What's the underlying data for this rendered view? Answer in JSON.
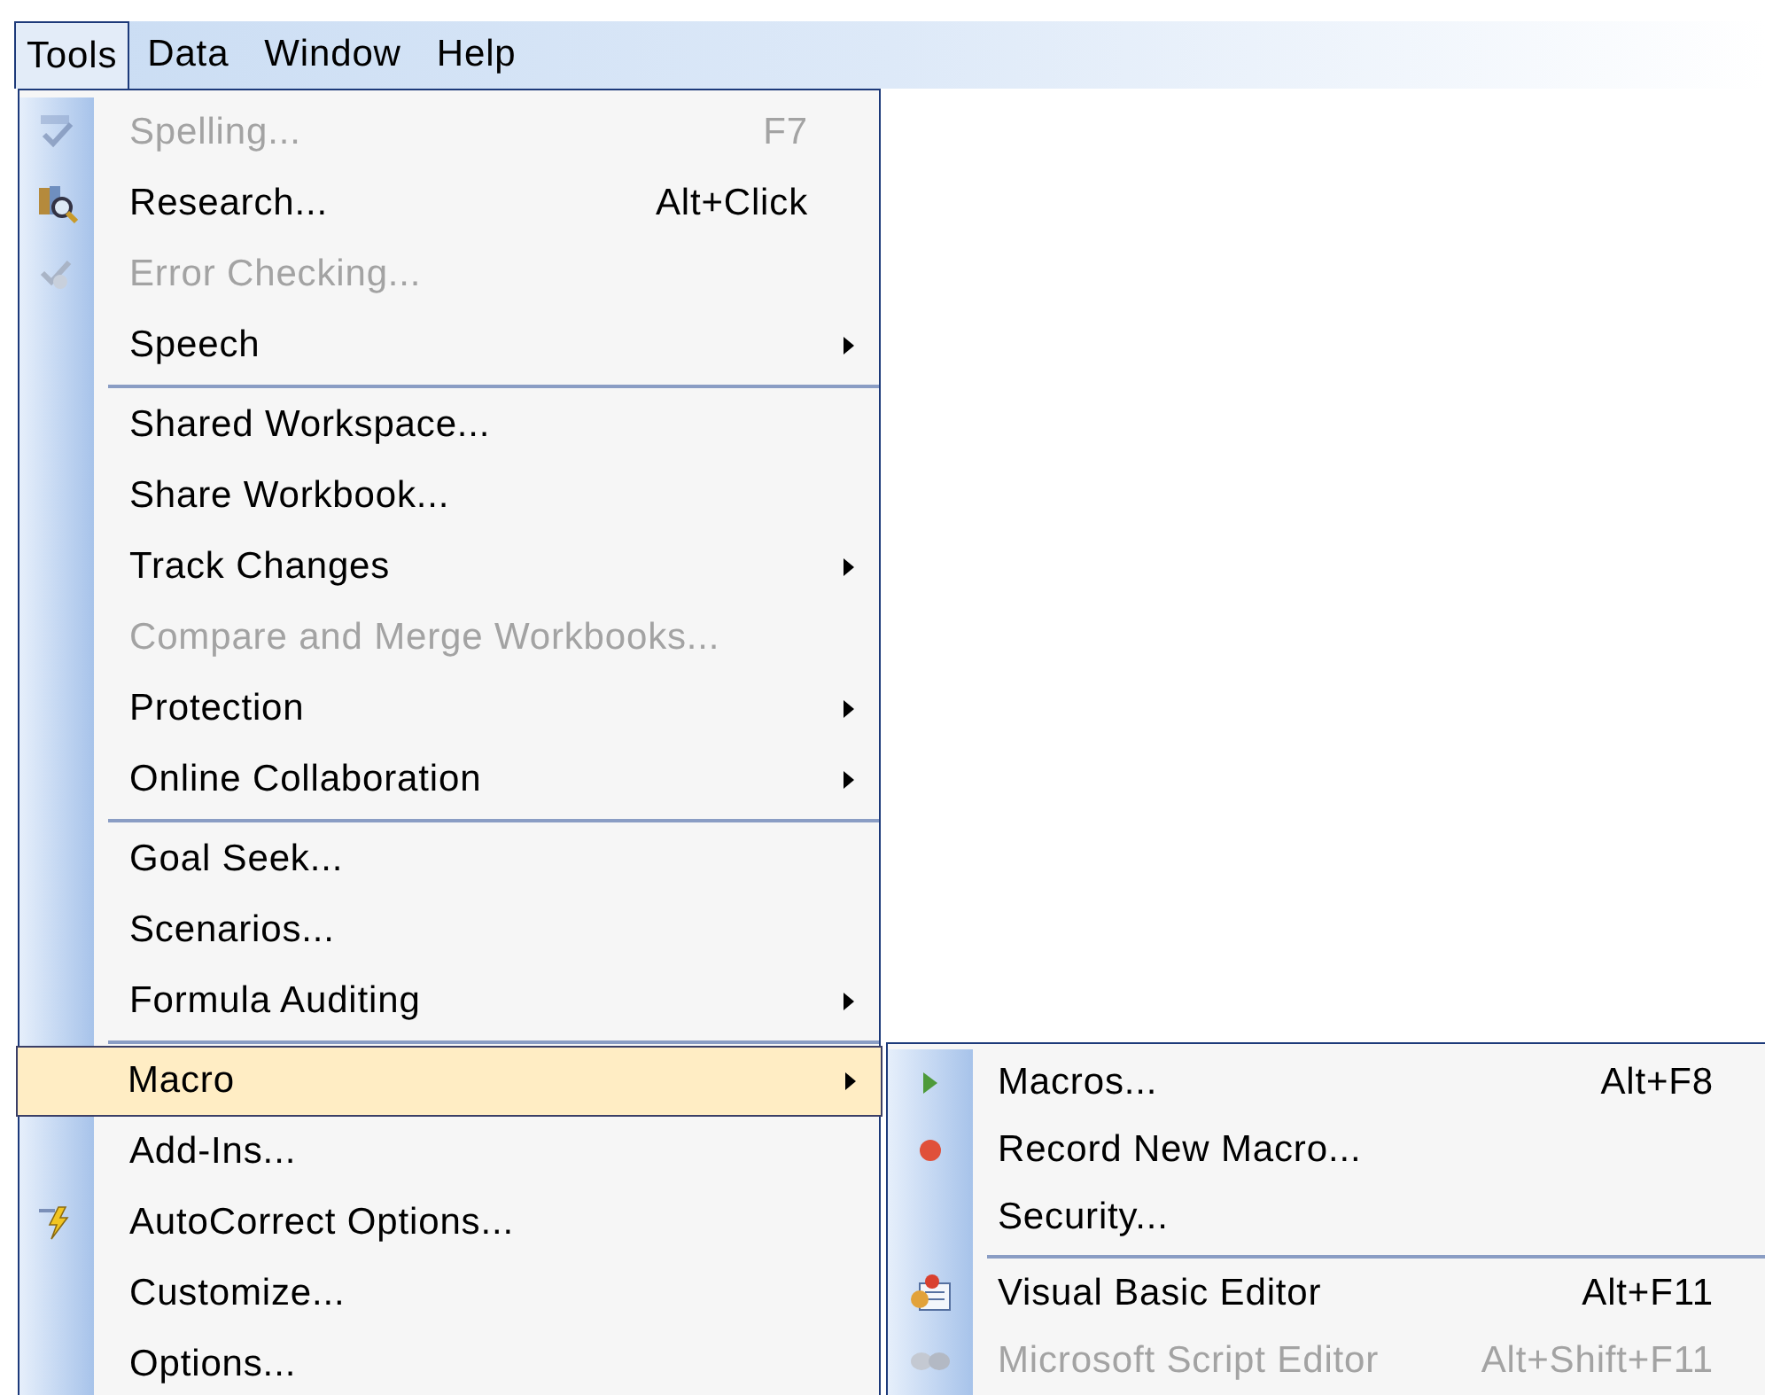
{
  "menubar": [
    {
      "label": "Tools",
      "selected": true
    },
    {
      "label": "Data",
      "selected": false
    },
    {
      "label": "Window",
      "selected": false
    },
    {
      "label": "Help",
      "selected": false
    }
  ],
  "menu": [
    {
      "label": "Spelling...",
      "shortcut": "F7",
      "disabled": true,
      "submenu": false,
      "separator_before": false,
      "selected": false,
      "kind": "spelling"
    },
    {
      "label": "Research...",
      "shortcut": "Alt+Click",
      "disabled": false,
      "submenu": false,
      "separator_before": false,
      "selected": false,
      "kind": "research"
    },
    {
      "label": "Error Checking...",
      "disabled": true,
      "submenu": false,
      "separator_before": false,
      "selected": false,
      "kind": "error-check"
    },
    {
      "label": "Speech",
      "disabled": false,
      "submenu": true,
      "separator_before": false,
      "selected": false
    },
    {
      "label": "Shared Workspace...",
      "disabled": false,
      "submenu": false,
      "separator_before": true,
      "selected": false
    },
    {
      "label": "Share Workbook...",
      "disabled": false,
      "submenu": false,
      "separator_before": false,
      "selected": false
    },
    {
      "label": "Track Changes",
      "disabled": false,
      "submenu": true,
      "separator_before": false,
      "selected": false
    },
    {
      "label": "Compare and Merge Workbooks...",
      "disabled": true,
      "submenu": false,
      "separator_before": false,
      "selected": false
    },
    {
      "label": "Protection",
      "disabled": false,
      "submenu": true,
      "separator_before": false,
      "selected": false
    },
    {
      "label": "Online Collaboration",
      "disabled": false,
      "submenu": true,
      "separator_before": false,
      "selected": false
    },
    {
      "label": "Goal Seek...",
      "disabled": false,
      "submenu": false,
      "separator_before": true,
      "selected": false
    },
    {
      "label": "Scenarios...",
      "disabled": false,
      "submenu": false,
      "separator_before": false,
      "selected": false
    },
    {
      "label": "Formula Auditing",
      "disabled": false,
      "submenu": true,
      "separator_before": false,
      "selected": false
    },
    {
      "label": "Macro",
      "disabled": false,
      "submenu": true,
      "separator_before": true,
      "selected": true
    },
    {
      "label": "Add-Ins...",
      "disabled": false,
      "submenu": false,
      "separator_before": false,
      "selected": false
    },
    {
      "label": "AutoCorrect Options...",
      "disabled": false,
      "submenu": false,
      "separator_before": false,
      "selected": false,
      "kind": "autocorrect"
    },
    {
      "label": "Customize...",
      "disabled": false,
      "submenu": false,
      "separator_before": false,
      "selected": false
    },
    {
      "label": "Options...",
      "disabled": false,
      "submenu": false,
      "separator_before": false,
      "selected": false
    }
  ],
  "submenu": [
    {
      "label": "Macros...",
      "shortcut": "Alt+F8",
      "disabled": false,
      "separator_before": false,
      "kind": "play"
    },
    {
      "label": "Record New Macro...",
      "disabled": false,
      "separator_before": false,
      "kind": "record"
    },
    {
      "label": "Security...",
      "disabled": false,
      "separator_before": false
    },
    {
      "label": "Visual Basic Editor",
      "shortcut": "Alt+F11",
      "disabled": false,
      "separator_before": true,
      "kind": "vb-editor"
    },
    {
      "label": "Microsoft Script Editor",
      "shortcut": "Alt+Shift+F11",
      "disabled": true,
      "separator_before": false,
      "kind": "script-editor"
    }
  ]
}
